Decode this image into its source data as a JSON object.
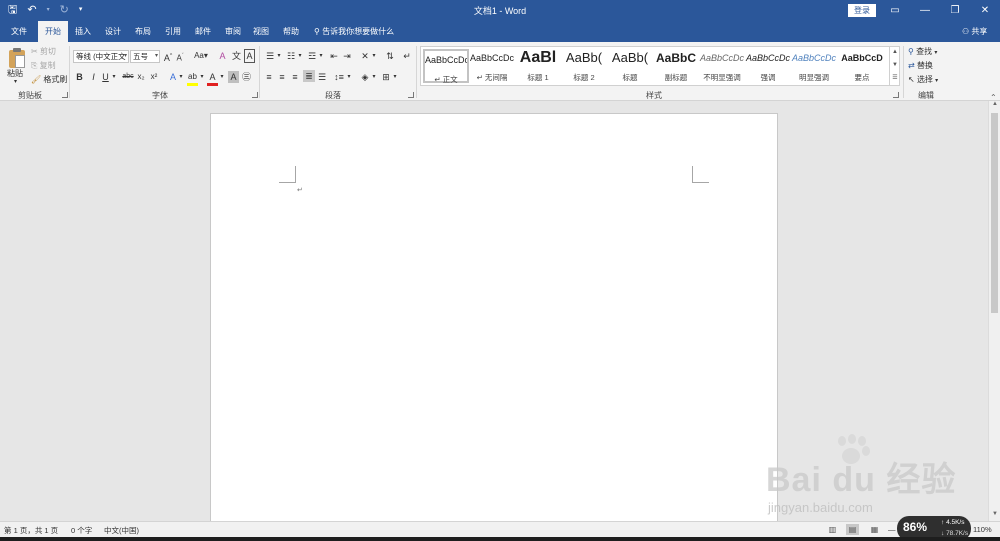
{
  "window": {
    "title": "文档1 - Word",
    "login_label": "登录",
    "controls": [
      "▭",
      "—",
      "❐",
      "✕"
    ]
  },
  "quick_access": {
    "save_icon": "save-icon",
    "undo_icon": "undo-icon",
    "redo_icon": "redo-icon",
    "customize_icon": "customize-qat-icon"
  },
  "tabs": [
    {
      "label": "文件",
      "active": false
    },
    {
      "label": "开始",
      "active": true
    },
    {
      "label": "插入",
      "active": false
    },
    {
      "label": "设计",
      "active": false
    },
    {
      "label": "布局",
      "active": false
    },
    {
      "label": "引用",
      "active": false
    },
    {
      "label": "邮件",
      "active": false
    },
    {
      "label": "审阅",
      "active": false
    },
    {
      "label": "视图",
      "active": false
    },
    {
      "label": "帮助",
      "active": false
    }
  ],
  "tell_me": "告诉我你想要做什么",
  "share": "共享",
  "clipboard": {
    "group_label": "剪贴板",
    "paste": "粘贴",
    "cut": "剪切",
    "copy": "复制",
    "format_painter": "格式刷"
  },
  "font": {
    "group_label": "字体",
    "font_name": "等线 (中文正文",
    "font_size": "五号",
    "grow": "A",
    "shrink": "A",
    "change_case": "Aa",
    "clear_format": "A",
    "phonetic": "文",
    "border_char": "A",
    "bold": "B",
    "italic": "I",
    "underline": "U",
    "strike": "abc",
    "subscript": "x₂",
    "superscript": "x²",
    "text_effects": "A",
    "highlight": "ab",
    "font_color": "A",
    "char_shading": "A",
    "enclose": "㊂",
    "font_color_value": "#e02020",
    "highlight_color_value": "#ffff00"
  },
  "paragraph": {
    "group_label": "段落"
  },
  "styles": {
    "group_label": "样式",
    "items": [
      {
        "sample": "AaBbCcDc",
        "name": "↵ 正文",
        "selected": true
      },
      {
        "sample": "AaBbCcDc",
        "name": "↵ 无间隔",
        "selected": false
      },
      {
        "sample": "AaBl",
        "name": "标题 1",
        "selected": false
      },
      {
        "sample": "AaBb(",
        "name": "标题 2",
        "selected": false
      },
      {
        "sample": "AaBb(",
        "name": "标题",
        "selected": false
      },
      {
        "sample": "AaBbC",
        "name": "副标题",
        "selected": false
      },
      {
        "sample": "AaBbCcDc",
        "name": "不明显强调",
        "selected": false
      },
      {
        "sample": "AaBbCcDc",
        "name": "强调",
        "selected": false
      },
      {
        "sample": "AaBbCcDc",
        "name": "明显强调",
        "selected": false
      },
      {
        "sample": "AaBbCcD",
        "name": "要点",
        "selected": false
      }
    ]
  },
  "editing": {
    "group_label": "编辑",
    "find": "查找",
    "replace": "替换",
    "select": "选择"
  },
  "document": {
    "paragraph_mark": "↵"
  },
  "status": {
    "page": "第 1 页，共 1 页",
    "words": "0 个字",
    "language": "中文(中国)",
    "zoom": "110%"
  },
  "speed_widget": {
    "percent": "86%",
    "upload": "4.5K/s",
    "download": "78.7K/s"
  },
  "watermark": {
    "main": "Bai du 经验",
    "sub": "jingyan.baidu.com"
  }
}
